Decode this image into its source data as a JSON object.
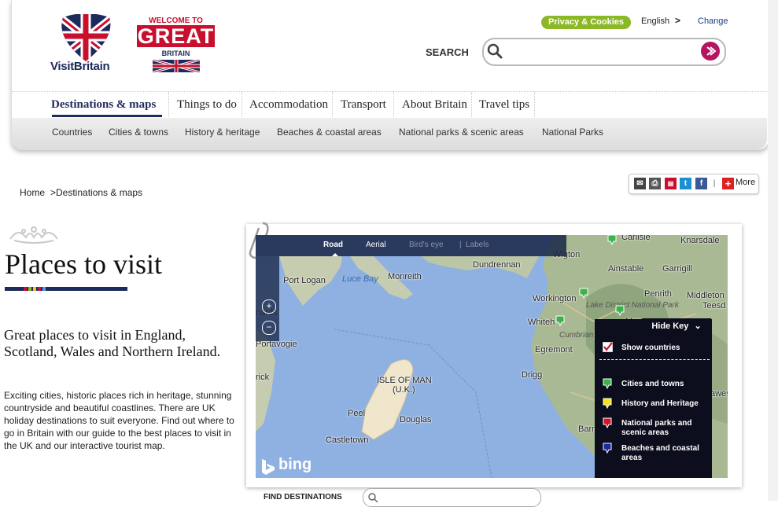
{
  "header": {
    "logo_text": "VisitBritain",
    "great_logo": {
      "top": "WELCOME TO",
      "main": "GREAT",
      "bottom": "BRITAIN"
    },
    "privacy_button": "Privacy & Cookies",
    "language": "English",
    "language_arrow": ">",
    "change_link": "Change",
    "search_label": "SEARCH",
    "search_placeholder": ""
  },
  "nav": {
    "top": [
      "Destinations & maps",
      "Things to do",
      "Accommodation",
      "Transport",
      "About Britain",
      "Travel tips"
    ],
    "sub": [
      "Countries",
      "Cities & towns",
      "History & heritage",
      "Beaches & coastal areas",
      "National parks & scenic areas",
      "National Parks"
    ]
  },
  "breadcrumb": {
    "home": "Home",
    "current": ">Destinations & maps"
  },
  "share": {
    "more_label": "More",
    "plus": "+"
  },
  "page": {
    "title": "Places to visit",
    "subtitle": "Great places to visit in England, Scotland, Wales and Northern Ireland.",
    "body": "Exciting cities, historic places rich in heritage, stunning countryside and beautiful coastlines. There are UK holiday destinations to suit everyone. Find out where to go in Britain with our guide to the best places to visit in the UK and our interactive tourist map."
  },
  "map": {
    "toolbar": {
      "road": "Road",
      "aerial": "Aerial",
      "birdseye": "Bird's eye",
      "labels": "Labels"
    },
    "zoom_in": "+",
    "zoom_out": "−",
    "places": {
      "port_logan": "Port Logan",
      "luce_bay": "Luce Bay",
      "monreith": "Monreith",
      "drummore": "Drummore",
      "dundrennan": "Dundrennan",
      "wigton": "Wigton",
      "carlisle": "Carlisle",
      "knarsdale": "Knarsdale",
      "aikton": "Ainstable",
      "garrigill": "Garrigill",
      "workington": "Workington",
      "penrith": "Penrith",
      "middleton": "Middleton",
      "teesdale": "Teesd",
      "lake_district": "Lake District National Park",
      "whitehaven": "Whiteh",
      "cumbrian": "Cumbrian Mountains",
      "egremont": "Egremont",
      "portavogie": "Portavogie",
      "ardglass": "rick",
      "isle_of_man": "ISLE OF MAN",
      "uk": "(U.K.)",
      "peel": "Peel",
      "douglas": "Douglas",
      "castletown": "Castletown",
      "drigg": "Drigg",
      "more": "Mor",
      "barrow": "Barr",
      "hawes": "awes",
      "ards": "nards"
    },
    "bing_text": "bing",
    "key": {
      "hide_key": "Hide Key",
      "show_countries": "Show countries",
      "items": [
        {
          "label": "Cities and towns",
          "color": "#3bb34a"
        },
        {
          "label": "History and Heritage",
          "color": "#f5e21b"
        },
        {
          "label": "National parks and scenic areas",
          "color": "#d2152b"
        },
        {
          "label": "Beaches and coastal areas",
          "color": "#1a2aa0"
        }
      ]
    }
  },
  "find_destinations": "FIND DESTINATIONS",
  "colors": {
    "brand_navy": "#1d2a5c",
    "great_red": "#c8102e",
    "accent_green": "#8cb826",
    "search_go": "#b3165e"
  }
}
